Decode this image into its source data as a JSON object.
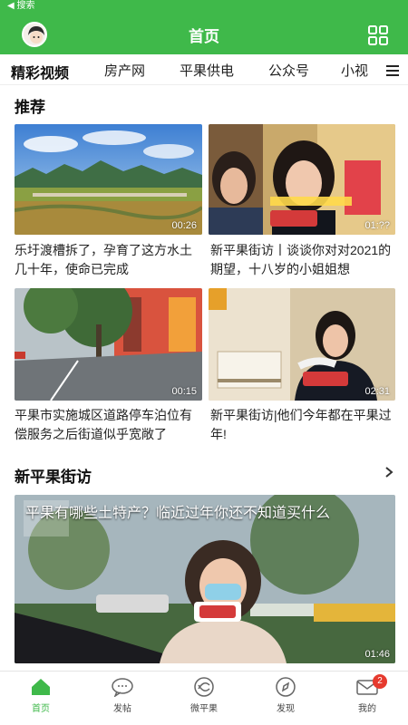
{
  "status_bar": {
    "back_label": "◀ 搜索"
  },
  "header": {
    "title": "首页"
  },
  "tabs": [
    "精彩视频",
    "房产网",
    "平果供电",
    "公众号",
    "小视"
  ],
  "recommend": {
    "title": "推荐",
    "cards": [
      {
        "caption": "乐圩渡槽拆了，孕育了这方水土几十年，使命已完成",
        "duration": "00:26"
      },
      {
        "caption": "新平果街访丨谈谈你对对2021的期望，十八岁的小姐姐想",
        "duration": "01:??"
      },
      {
        "caption": "平果市实施城区道路停车泊位有偿服务之后街道似乎宽敞了",
        "duration": "00:15"
      },
      {
        "caption": "新平果街访|他们今年都在平果过年!",
        "duration": "02:31"
      }
    ]
  },
  "street": {
    "title": "新平果街访",
    "video_title": "平果有哪些土特产？临近过年你还不知道买什么",
    "duration": "01:46"
  },
  "tabbar": [
    {
      "label": "首页",
      "icon": "home-icon"
    },
    {
      "label": "发帖",
      "icon": "chat-icon"
    },
    {
      "label": "微平果",
      "icon": "logo-icon"
    },
    {
      "label": "发现",
      "icon": "compass-icon"
    },
    {
      "label": "我的",
      "icon": "mail-icon",
      "badge": "2"
    }
  ],
  "colors": {
    "brand": "#3fb94a",
    "badge": "#e63a2e"
  }
}
